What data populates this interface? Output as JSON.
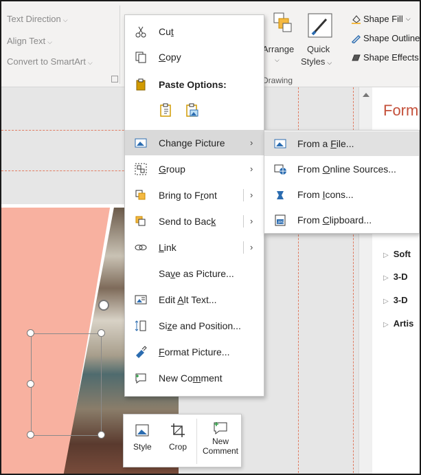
{
  "ribbon": {
    "text_direction": "Text Direction",
    "align_text": "Align Text",
    "convert_smartart": "Convert to SmartArt",
    "arrange": "Arrange",
    "quick_styles_line1": "Quick",
    "quick_styles_line2": "Styles",
    "drawing_group": "Drawing",
    "shape_fill": "Shape Fill",
    "shape_outline": "Shape Outline",
    "shape_effects": "Shape Effects"
  },
  "context_menu": {
    "cut": "Cut",
    "copy": "Copy",
    "paste_options": "Paste Options:",
    "change_picture": "Change Picture",
    "group": "Group",
    "bring_to_front": "Bring to Front",
    "send_to_back": "Send to Back",
    "link": "Link",
    "save_as_picture": "Save as Picture...",
    "edit_alt_text": "Edit Alt Text...",
    "size_and_position": "Size and Position...",
    "format_picture": "Format Picture...",
    "new_comment": "New Comment"
  },
  "submenu": {
    "from_file": "From a File...",
    "from_online": "From Online Sources...",
    "from_icons": "From Icons...",
    "from_clipboard": "From Clipboard..."
  },
  "mini_toolbar": {
    "style": "Style",
    "crop": "Crop",
    "new_comment_line1": "New",
    "new_comment_line2": "Comment"
  },
  "pane": {
    "title": "Form",
    "items": [
      "Soft",
      "3-D",
      "3-D",
      "Artis"
    ]
  },
  "colors": {
    "accent": "#c4503a",
    "slide_shape": "#f8b1a0",
    "icon_blue": "#2b6cb0",
    "icon_gold": "#d19a00"
  }
}
